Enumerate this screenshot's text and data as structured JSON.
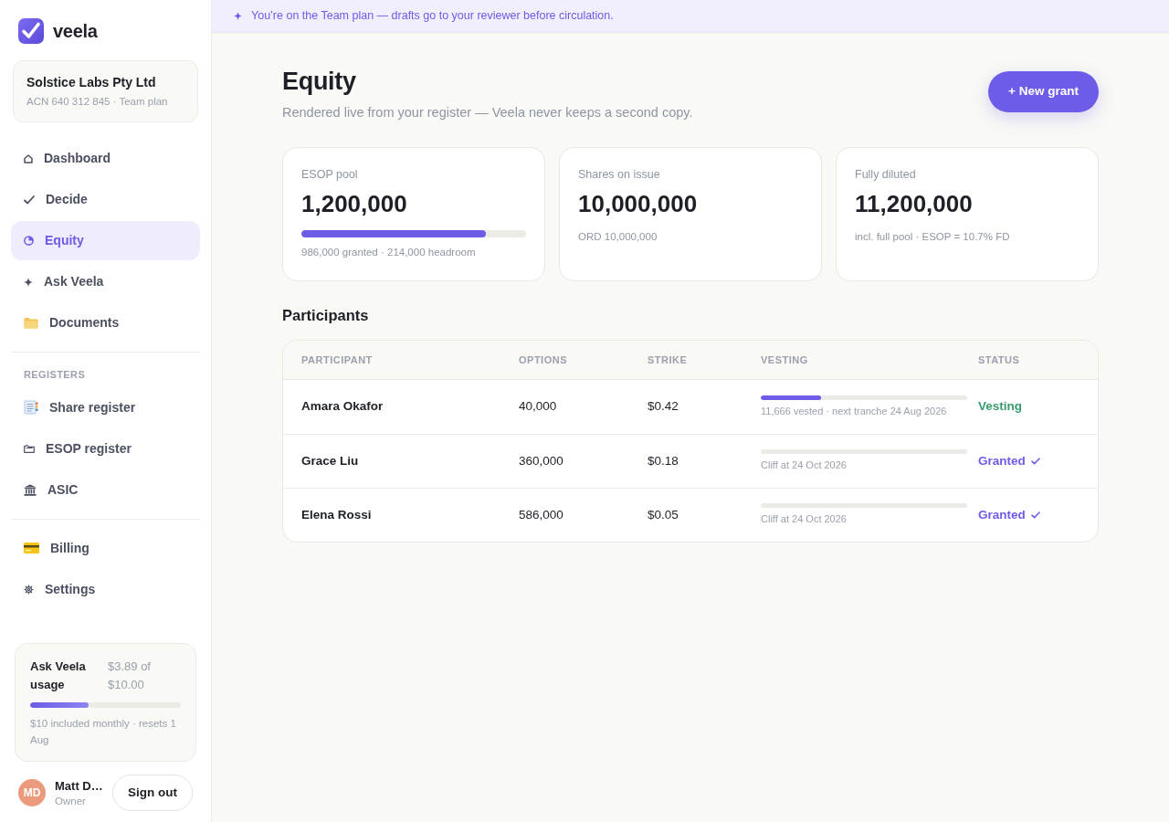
{
  "sidebar": {
    "brand": {
      "name": "veela"
    },
    "org": {
      "name": "Solstice Labs Pty Ltd",
      "meta": "ACN 640 312 845 · Team plan"
    },
    "nav_groups": [
      {
        "items": [
          {
            "label": "Dashboard",
            "selected": false
          },
          {
            "label": "Decide",
            "selected": false
          },
          {
            "label": "Equity",
            "selected": true
          },
          {
            "label": "Ask Veela",
            "selected": false
          },
          {
            "label": "Documents",
            "selected": false
          }
        ]
      },
      {
        "heading": "REGISTERS",
        "items": [
          {
            "label": "Share register",
            "selected": false
          },
          {
            "label": "ESOP register",
            "selected": false
          },
          {
            "label": "ASIC",
            "selected": false
          }
        ]
      },
      {
        "items": [
          {
            "label": "Billing",
            "selected": false
          },
          {
            "label": "Settings",
            "selected": false
          }
        ]
      }
    ],
    "usage": {
      "title": "Ask Veela usage",
      "amount": "$3.89 of $10.00",
      "level": 0.39,
      "note": "$10 included monthly · resets 1 Aug"
    },
    "user": {
      "initials": "MD",
      "name": "Matt D…",
      "role": "Owner"
    },
    "sign_out": "Sign out"
  },
  "banner": {
    "text": "You’re on the Team plan — drafts go to your reviewer before circulation."
  },
  "header": {
    "title": "Equity",
    "subtitle": "Rendered live from your register — Veela never keeps a second copy.",
    "action": "+ New grant"
  },
  "stats": [
    {
      "label": "ESOP pool",
      "value": "1,200,000",
      "level": 0.82,
      "note": "986,000 granted · 214,000 headroom"
    },
    {
      "label": "Shares on issue",
      "value": "10,000,000",
      "note": "ORD 10,000,000"
    },
    {
      "label": "Fully diluted",
      "value": "11,200,000",
      "note": "incl. full pool · ESOP = 10.7% FD"
    }
  ],
  "participants": {
    "title": "Participants",
    "columns": [
      "PARTICIPANT",
      "OPTIONS",
      "STRIKE",
      "VESTING",
      "STATUS"
    ],
    "rows": [
      {
        "name": "Amara Okafor",
        "options": "40,000",
        "strike": "$0.42",
        "vesting": {
          "level": 0.29,
          "note": "11,666 vested · next tranche 24 Aug 2026"
        },
        "status": {
          "label": "Vesting",
          "kind": "vesting"
        }
      },
      {
        "name": "Grace Liu",
        "options": "360,000",
        "strike": "$0.18",
        "vesting": {
          "note": "Cliff at 24 Oct 2026"
        },
        "status": {
          "label": "Granted",
          "kind": "granted"
        }
      },
      {
        "name": "Elena Rossi",
        "options": "586,000",
        "strike": "$0.05",
        "vesting": {
          "note": "Cliff at 24 Oct 2026"
        },
        "status": {
          "label": "Granted",
          "kind": "granted"
        }
      }
    ]
  }
}
